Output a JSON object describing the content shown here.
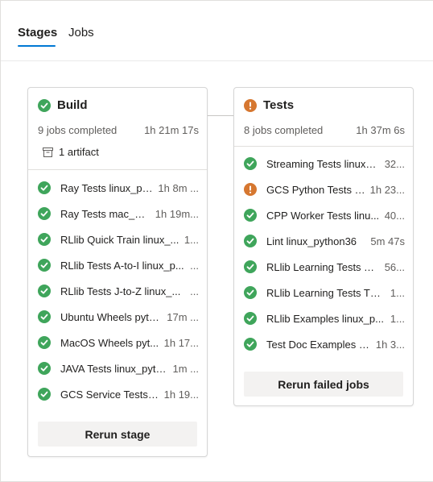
{
  "tabs": {
    "stages": "Stages",
    "jobs": "Jobs"
  },
  "colors": {
    "success": "#3fa55b",
    "warning": "#d67730",
    "accent": "#0078d4"
  },
  "stages": [
    {
      "title": "Build",
      "status_icon": "success-check-icon",
      "jobs_completed": "9 jobs completed",
      "duration": "1h 21m 17s",
      "artifact": "1 artifact",
      "jobs": [
        {
          "name": "Ray Tests linux_pyt...",
          "time": "1h 8m ...",
          "status": "success"
        },
        {
          "name": "Ray Tests mac_pyt...",
          "time": "1h 19m...",
          "status": "success"
        },
        {
          "name": "RLlib Quick Train linux_...",
          "time": "1...",
          "status": "success"
        },
        {
          "name": "RLlib Tests A-to-I linux_p...",
          "time": "...",
          "status": "success"
        },
        {
          "name": "RLlib Tests J-to-Z linux_...",
          "time": "...",
          "status": "success"
        },
        {
          "name": "Ubuntu Wheels pyth...",
          "time": "17m ...",
          "status": "success"
        },
        {
          "name": "MacOS Wheels pyt...",
          "time": "1h 17...",
          "status": "success"
        },
        {
          "name": "JAVA Tests linux_pyth...",
          "time": "1m ...",
          "status": "success"
        },
        {
          "name": "GCS Service Tests li...",
          "time": "1h 19...",
          "status": "success"
        }
      ],
      "button": "Rerun stage"
    },
    {
      "title": "Tests",
      "status_icon": "warning-exclamation-icon",
      "jobs_completed": "8 jobs completed",
      "duration": "1h 37m 6s",
      "jobs": [
        {
          "name": "Streaming Tests linux_...",
          "time": "32...",
          "status": "success"
        },
        {
          "name": "GCS Python Tests li...",
          "time": "1h 23...",
          "status": "warning"
        },
        {
          "name": "CPP Worker Tests linu...",
          "time": "40...",
          "status": "success"
        },
        {
          "name": "Lint linux_python36",
          "time": "5m 47s",
          "status": "success"
        },
        {
          "name": "RLlib Learning Tests TF...",
          "time": "56...",
          "status": "success"
        },
        {
          "name": "RLlib Learning Tests TF ...",
          "time": "1...",
          "status": "success"
        },
        {
          "name": "RLlib Examples linux_p...",
          "time": "1...",
          "status": "success"
        },
        {
          "name": "Test Doc Examples li...",
          "time": "1h 3...",
          "status": "success"
        }
      ],
      "button": "Rerun failed jobs"
    }
  ]
}
